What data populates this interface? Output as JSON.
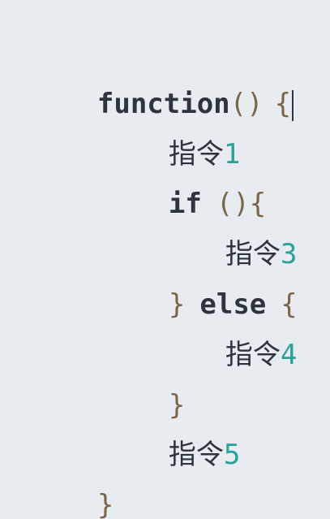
{
  "code": {
    "line1": {
      "keyword": "function",
      "parens": "()",
      "brace": "{"
    },
    "line2": {
      "text": "指令",
      "number": "1"
    },
    "line3": {
      "keyword": "if",
      "cond": "()",
      "brace": "{"
    },
    "line4": {
      "text": "指令",
      "number": "3"
    },
    "line5": {
      "close": "}",
      "keyword": "else",
      "brace": "{"
    },
    "line6": {
      "text": "指令",
      "number": "4"
    },
    "line7": {
      "close": "}"
    },
    "line8": {
      "text": "指令",
      "number": "5"
    },
    "line9": {
      "close": "}"
    }
  },
  "colors": {
    "background": "#e8ecf0",
    "keyword": "#2c3440",
    "punctuation": "#7a6548",
    "number": "#2aa198"
  }
}
